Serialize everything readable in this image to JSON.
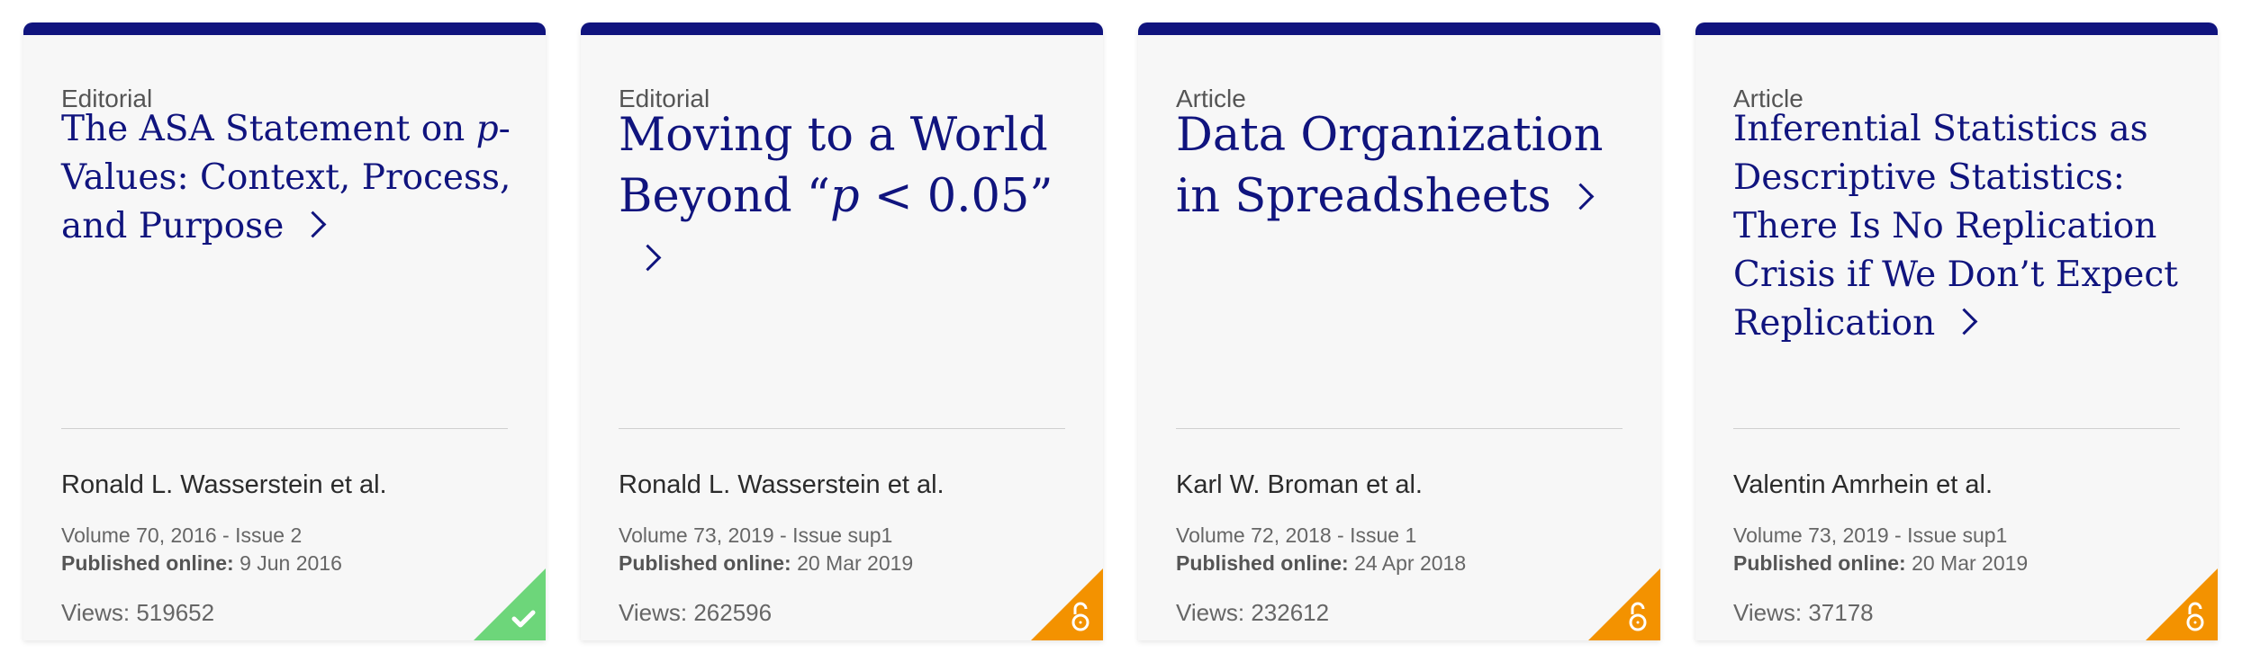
{
  "colors": {
    "accent": "#10147e",
    "card_background": "#f7f7f7",
    "free_access_badge": "#6dd67a",
    "open_access_badge": "#f39200"
  },
  "cards": [
    {
      "type": "Editorial",
      "title_pre": "The ASA Statement on ",
      "title_italic": "p",
      "title_post": "-Values: Context, Process, and Purpose",
      "authors": "Ronald L. Wasserstein et al.",
      "volume": "Volume 70, 2016 - Issue 2",
      "published_label": "Published online:",
      "published_date": "9 Jun 2016",
      "views": "Views: 519652",
      "badge_icon": "checkmark-icon"
    },
    {
      "type": "Editorial",
      "title_pre": "Moving to a World Beyond “",
      "title_italic": "p",
      "title_post": " < 0.05”",
      "authors": "Ronald L. Wasserstein et al.",
      "volume": "Volume 73, 2019 - Issue sup1",
      "published_label": "Published online:",
      "published_date": "20 Mar 2019",
      "views": "Views: 262596",
      "badge_icon": "open-lock-icon"
    },
    {
      "type": "Article",
      "title_pre": "Data Organization in Spreadsheets",
      "title_italic": "",
      "title_post": "",
      "authors": "Karl W. Broman et al.",
      "volume": "Volume 72, 2018 - Issue 1",
      "published_label": "Published online:",
      "published_date": "24 Apr 2018",
      "views": "Views: 232612",
      "badge_icon": "open-lock-icon"
    },
    {
      "type": "Article",
      "title_pre": "Inferential Statistics as Descriptive Statistics: There Is No Replication Crisis if We Don’t Expect Replication",
      "title_italic": "",
      "title_post": "",
      "authors": "Valentin Amrhein et al.",
      "volume": "Volume 73, 2019 - Issue sup1",
      "published_label": "Published online:",
      "published_date": "20 Mar 2019",
      "views": "Views: 37178",
      "badge_icon": "open-lock-icon"
    }
  ]
}
